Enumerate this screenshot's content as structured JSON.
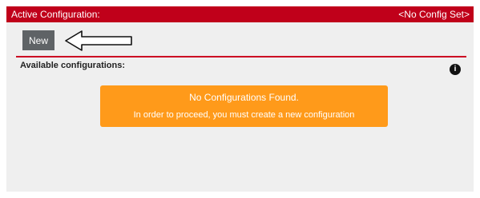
{
  "header": {
    "label": "Active Configuration:",
    "value": "<No Config Set>"
  },
  "toolbar": {
    "new_label": "New",
    "arrow_icon": "left-arrow-outline-icon"
  },
  "section": {
    "title": "Available configurations:",
    "info_icon": "info-icon",
    "info_glyph": "i"
  },
  "alert": {
    "title": "No Configurations Found.",
    "message": "In order to proceed, you must create a new configuration"
  },
  "colors": {
    "header_red": "#c0001a",
    "alert_orange": "#ff9a1a",
    "button_gray": "#5f6366",
    "panel_gray": "#efefef"
  }
}
